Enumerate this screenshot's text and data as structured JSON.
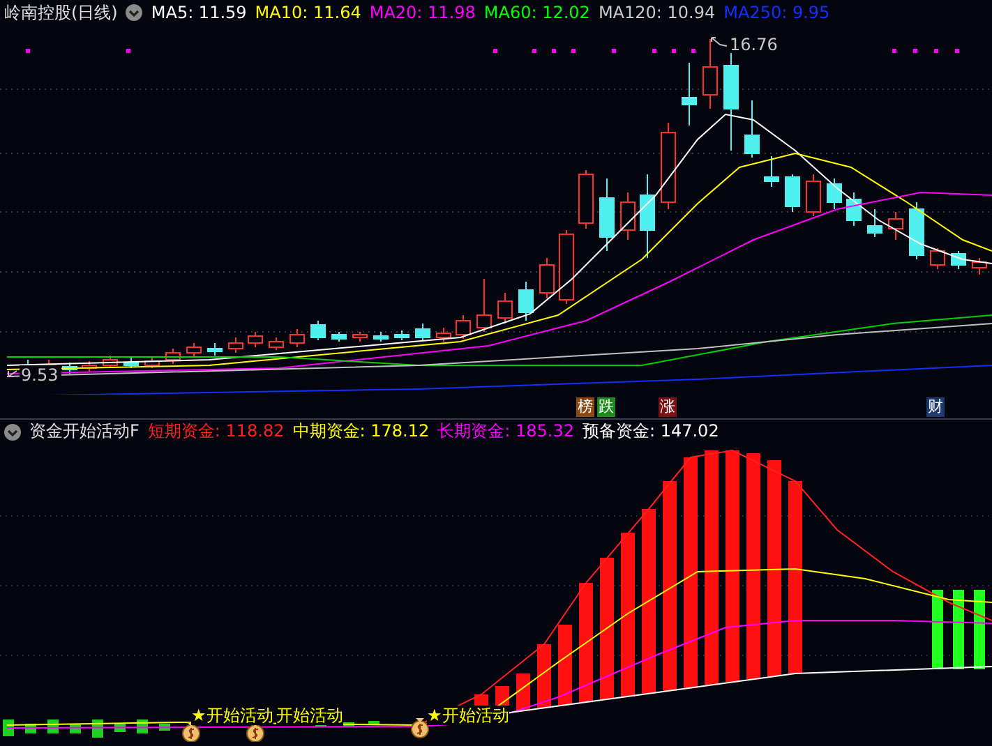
{
  "title": "岭南控股(日线)",
  "ma_legend": [
    {
      "label": "MA5: 11.59",
      "color": "#ffffff"
    },
    {
      "label": "MA10: 11.64",
      "color": "#ffff00"
    },
    {
      "label": "MA20: 11.98",
      "color": "#ff00ff"
    },
    {
      "label": "MA60: 12.02",
      "color": "#00ff00"
    },
    {
      "label": "MA120: 10.94",
      "color": "#c8c8c8"
    },
    {
      "label": "MA250: 9.95",
      "color": "#1030ff"
    }
  ],
  "price_chart": {
    "high_label": "16.76",
    "low_label": "9.53"
  },
  "event_marks": [
    {
      "label": "榜",
      "color": "#8b4a14"
    },
    {
      "label": "跌",
      "color": "#1e8a1e"
    },
    {
      "label": "涨",
      "color": "#7a1414"
    },
    {
      "label": "财",
      "color": "#1c3a6e"
    }
  ],
  "indicator": {
    "name": "资金开始活动F",
    "values": [
      {
        "label": "短期资金: 118.82",
        "color": "#ff2020"
      },
      {
        "label": "中期资金: 178.12",
        "color": "#ffff00"
      },
      {
        "label": "长期资金: 185.32",
        "color": "#ff00ff"
      },
      {
        "label": "预备资金: 147.02",
        "color": "#ffffff"
      }
    ]
  },
  "signals": [
    {
      "label": "★开始活动"
    },
    {
      "label": "开始活动"
    },
    {
      "label": "★开始活动"
    }
  ]
}
